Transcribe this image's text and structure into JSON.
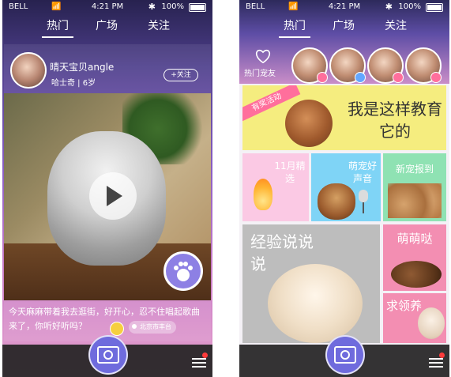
{
  "screens": [
    {
      "status": {
        "carrier": "BELL",
        "time": "4:21 PM",
        "battery": "100%"
      },
      "tabs": [
        {
          "label": "热门"
        },
        {
          "label": "广场"
        },
        {
          "label": "关注"
        }
      ],
      "user": {
        "name": "晴天宝贝angle",
        "sub": "哈士奇 | 6岁"
      },
      "follow_label": "+关注",
      "caption": "今天麻麻带着我去逛街，好开心，忍不住唱起歌曲来了，你听好听吗？",
      "location": "北京市丰台"
    },
    {
      "status": {
        "carrier": "BELL",
        "time": "4:21 PM",
        "battery": "100%"
      },
      "tabs": [
        {
          "label": "热门"
        },
        {
          "label": "广场"
        },
        {
          "label": "关注"
        }
      ],
      "pet_friends": "热门宠友",
      "banner": {
        "ribbon": "有奖活动",
        "title": "我是这样教育它的"
      },
      "tiles": {
        "t2": "11月精选",
        "t3": "萌宠好声音",
        "t4": "新宠报到",
        "t5": "经验说说说",
        "t6": "萌萌哒",
        "t7": "求领养"
      }
    }
  ],
  "icons": [
    "wifi-icon",
    "bluetooth-icon",
    "battery-icon",
    "play-icon",
    "paw-icon",
    "camera-icon",
    "menu-icon",
    "location-icon",
    "heart-icon",
    "emoji-icon",
    "female-icon",
    "male-icon"
  ],
  "colors": {
    "accent": "#6f6bdd",
    "pink": "#f38eb2",
    "yellow": "#f5ed7f",
    "blue": "#7fd4f6",
    "green": "#8fe2b3"
  }
}
